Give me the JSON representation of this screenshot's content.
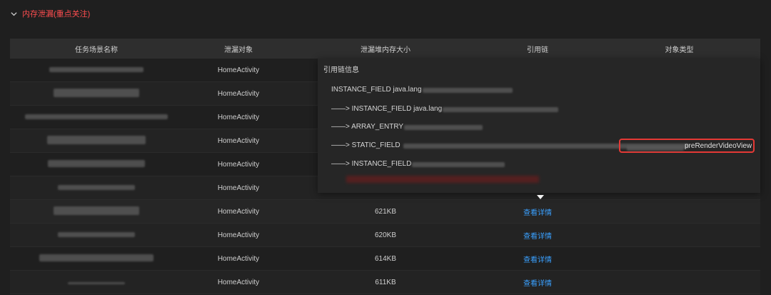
{
  "section": {
    "title": "内存泄漏(重点关注)",
    "icon": "chevron-down-icon"
  },
  "table": {
    "headers": [
      "任务场景名称",
      "泄漏对象",
      "泄漏堆内存大小",
      "引用链",
      "对象类型"
    ],
    "rows": [
      {
        "object": "HomeActivity",
        "size": "",
        "link": ""
      },
      {
        "object": "HomeActivity",
        "size": "",
        "link": ""
      },
      {
        "object": "HomeActivity",
        "size": "",
        "link": ""
      },
      {
        "object": "HomeActivity",
        "size": "",
        "link": ""
      },
      {
        "object": "HomeActivity",
        "size": "",
        "link": ""
      },
      {
        "object": "HomeActivity",
        "size": "",
        "link": ""
      },
      {
        "object": "HomeActivity",
        "size": "621KB",
        "link": "查看详情"
      },
      {
        "object": "HomeActivity",
        "size": "620KB",
        "link": "查看详情"
      },
      {
        "object": "HomeActivity",
        "size": "614KB",
        "link": "查看详情"
      },
      {
        "object": "HomeActivity",
        "size": "611KB",
        "link": "查看详情"
      }
    ]
  },
  "popup": {
    "title": "引用链信息",
    "lines": [
      "INSTANCE_FIELD java.lang",
      "——> INSTANCE_FIELD java.lang",
      "——> ARRAY_ENTRY",
      "——> STATIC_FIELD",
      "——> INSTANCE_FIELD"
    ],
    "highlight": "preRenderVideoView"
  },
  "colors": {
    "accent": "#ff4d4f",
    "link": "#3aa0ff",
    "highlight_border": "#e53935"
  }
}
